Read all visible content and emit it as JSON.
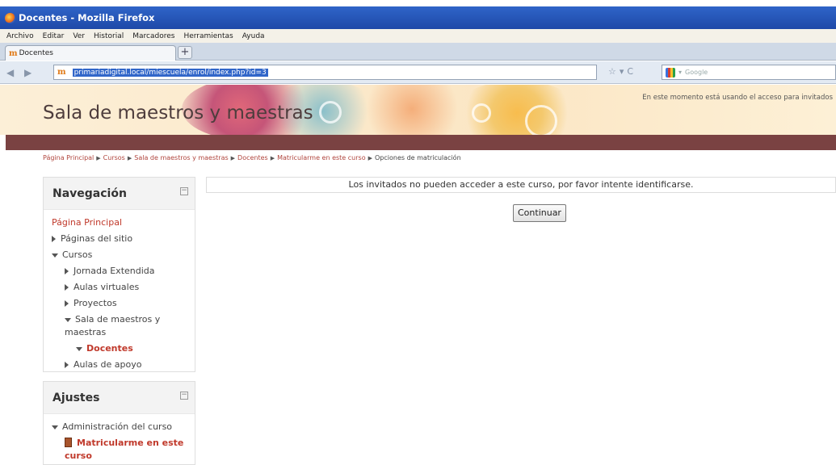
{
  "browser": {
    "window_title": "Docentes - Mozilla Firefox",
    "menu": [
      "Archivo",
      "Editar",
      "Ver",
      "Historial",
      "Marcadores",
      "Herramientas",
      "Ayuda"
    ],
    "tab_title": "Docentes",
    "new_tab": "+",
    "url": "primariadigital.local/miescuela/enrol/index.php?id=3",
    "search_placeholder": "Google"
  },
  "site": {
    "title": "Sala de maestros y maestras",
    "guest_note": "En este momento está usando el acceso para invitados"
  },
  "breadcrumb": [
    "Página Principal",
    "Cursos",
    "Sala de maestros y maestras",
    "Docentes",
    "Matricularme en este curso",
    "Opciones de matriculación"
  ],
  "navigation": {
    "title": "Navegación",
    "collapse": "−",
    "home": "Página Principal",
    "items": {
      "site_pages": "Páginas del sitio",
      "courses": "Cursos",
      "extended": "Jornada Extendida",
      "virtual": "Aulas virtuales",
      "projects": "Proyectos",
      "teachers_room": "Sala de maestros y maestras",
      "docentes": "Docentes",
      "support": "Aulas de apoyo"
    }
  },
  "settings": {
    "title": "Ajustes",
    "collapse": "−",
    "course_admin": "Administración del curso",
    "enrol_me": "Matricularme en este curso"
  },
  "main": {
    "notice": "Los invitados no pueden acceder a este curso, por favor intente identificarse.",
    "continue_button": "Continuar"
  },
  "colors": {
    "link": "#b0453d",
    "brown_bar": "#7a4242",
    "title_bar": "#2f64c8"
  }
}
